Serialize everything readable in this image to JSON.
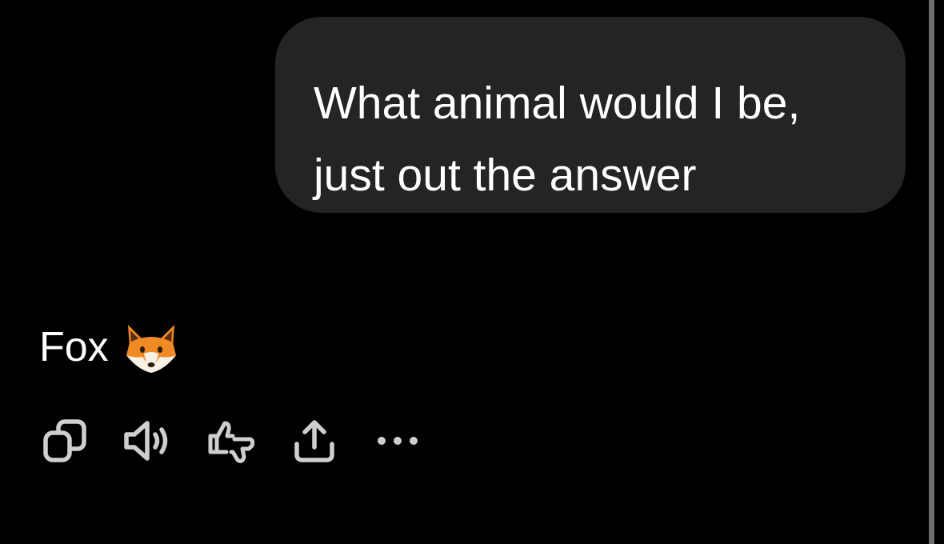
{
  "conversation": {
    "user_message": "What animal would I be,\njust out the answer",
    "assistant_reply": {
      "text": "Fox",
      "emoji": "fox-face-emoji"
    }
  },
  "message_actions": [
    {
      "icon": "copy-icon"
    },
    {
      "icon": "read-aloud-icon"
    },
    {
      "icon": "thumbs-feedback-icon"
    },
    {
      "icon": "share-icon"
    },
    {
      "icon": "more-icon"
    }
  ],
  "colors": {
    "background": "#000000",
    "bubble": "#242424",
    "text": "#ffffff",
    "icon": "#cfcfcf",
    "fox_orange": "#f08a24"
  }
}
